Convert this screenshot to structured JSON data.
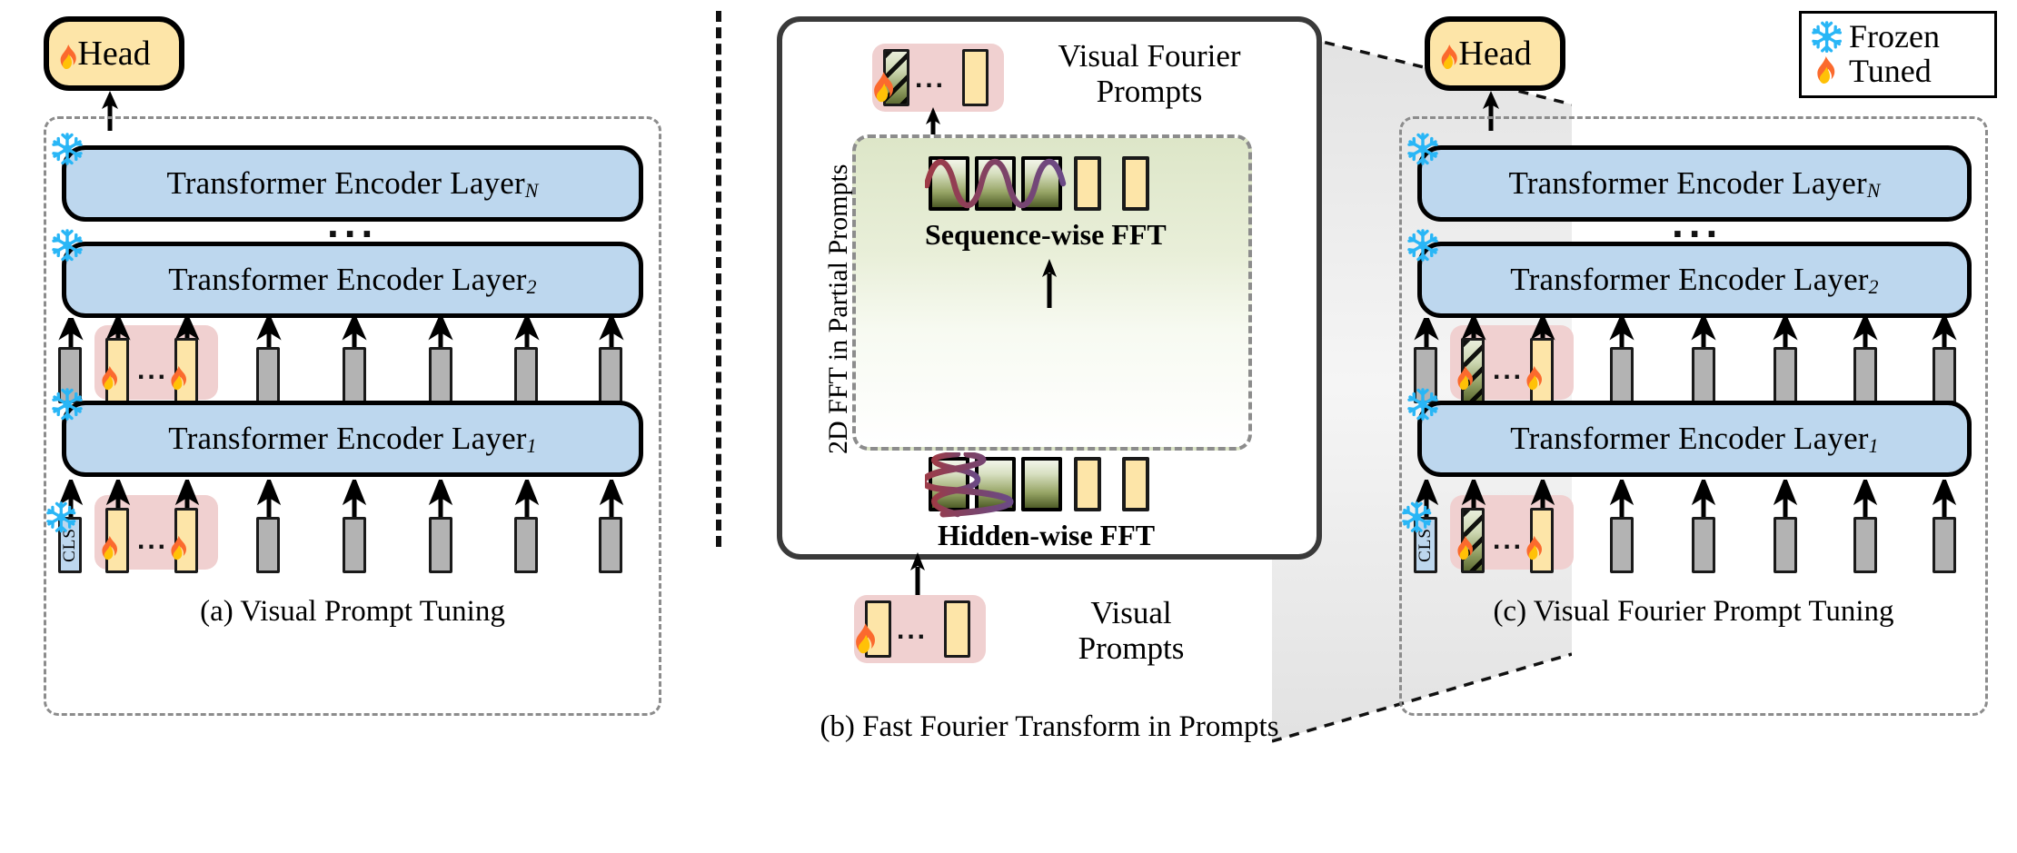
{
  "figure": {
    "panels": [
      {
        "id": "a",
        "caption": "(a) Visual Prompt Tuning"
      },
      {
        "id": "b",
        "caption": "(b)  Fast Fourier Transform in Prompts"
      },
      {
        "id": "c",
        "caption": "(c) Visual Fourier Prompt Tuning"
      }
    ]
  },
  "panel_a": {
    "head_label": "Head",
    "layers": [
      {
        "label_prefix": "Transformer Encoder Layer ",
        "label_sub": "N",
        "state": "frozen"
      },
      {
        "label_prefix": "Transformer Encoder Layer ",
        "label_sub": "2",
        "state": "frozen"
      },
      {
        "label_prefix": "Transformer Encoder Layer ",
        "label_sub": "1",
        "state": "frozen"
      }
    ],
    "vertical_ellipsis": "...",
    "prompt_ellipsis": "...",
    "cls_label": "CLS",
    "caption": "(a) Visual Prompt Tuning"
  },
  "panel_b": {
    "caption": "(b)  Fast Fourier Transform in Prompts",
    "vertical_label": "2D FFT in Partial Prompts",
    "top_group_label_line1": "Visual Fourier",
    "top_group_label_line2": "Prompts",
    "bottom_group_label_line1": "Visual",
    "bottom_group_label_line2": "Prompts",
    "fft_top_label": "Sequence-wise FFT",
    "fft_bottom_label": "Hidden-wise FFT",
    "ellipsis": "..."
  },
  "panel_c": {
    "head_label": "Head",
    "layers": [
      {
        "label_prefix": "Transformer Encoder Layer ",
        "label_sub": "N",
        "state": "frozen"
      },
      {
        "label_prefix": "Transformer Encoder Layer ",
        "label_sub": "2",
        "state": "frozen"
      },
      {
        "label_prefix": "Transformer Encoder Layer ",
        "label_sub": "1",
        "state": "frozen"
      }
    ],
    "vertical_ellipsis": "...",
    "prompt_ellipsis": "...",
    "cls_label": "CLS",
    "caption": "(c) Visual Fourier Prompt Tuning"
  },
  "legend": {
    "items": [
      {
        "icon": "snowflake-icon",
        "label": "Frozen"
      },
      {
        "icon": "flame-icon",
        "label": "Tuned"
      }
    ]
  },
  "colors": {
    "encoder_blue": "#bdd7ee",
    "head_yellow": "#fde5a8",
    "prompt_pink": "#f0d0d0",
    "prompt_yellow": "#fde5a8",
    "token_gray": "#b3b3b3",
    "fft_green": "#cfd9b4",
    "wave_red": "#9e3b47",
    "wave_purple": "#6b4a86",
    "dashed_gray": "#8c8c8c",
    "frozen_cyan": "#4fc3f7",
    "tuned_orange": "#fb6a2e"
  }
}
